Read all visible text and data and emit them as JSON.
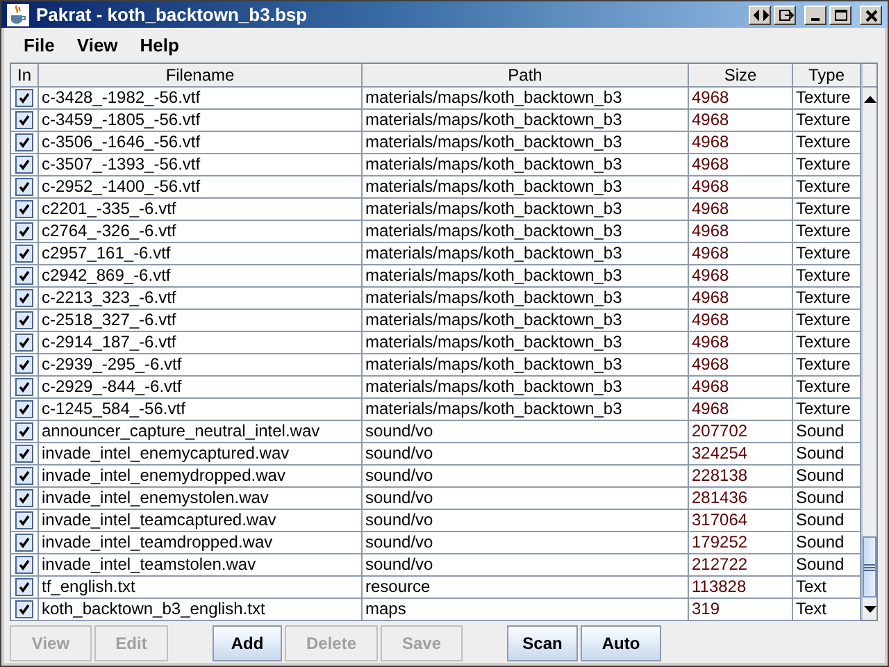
{
  "window": {
    "title": "Pakrat - koth_backtown_b3.bsp"
  },
  "menu": [
    "File",
    "View",
    "Help"
  ],
  "table": {
    "columns": [
      "In",
      "Filename",
      "Path",
      "Size",
      "Type"
    ],
    "rows": [
      {
        "checked": true,
        "filename": "c-3428_-1982_-56.vtf",
        "path": "materials/maps/koth_backtown_b3",
        "size": "4968",
        "type": "Texture"
      },
      {
        "checked": true,
        "filename": "c-3459_-1805_-56.vtf",
        "path": "materials/maps/koth_backtown_b3",
        "size": "4968",
        "type": "Texture"
      },
      {
        "checked": true,
        "filename": "c-3506_-1646_-56.vtf",
        "path": "materials/maps/koth_backtown_b3",
        "size": "4968",
        "type": "Texture"
      },
      {
        "checked": true,
        "filename": "c-3507_-1393_-56.vtf",
        "path": "materials/maps/koth_backtown_b3",
        "size": "4968",
        "type": "Texture"
      },
      {
        "checked": true,
        "filename": "c-2952_-1400_-56.vtf",
        "path": "materials/maps/koth_backtown_b3",
        "size": "4968",
        "type": "Texture"
      },
      {
        "checked": true,
        "filename": "c2201_-335_-6.vtf",
        "path": "materials/maps/koth_backtown_b3",
        "size": "4968",
        "type": "Texture"
      },
      {
        "checked": true,
        "filename": "c2764_-326_-6.vtf",
        "path": "materials/maps/koth_backtown_b3",
        "size": "4968",
        "type": "Texture"
      },
      {
        "checked": true,
        "filename": "c2957_161_-6.vtf",
        "path": "materials/maps/koth_backtown_b3",
        "size": "4968",
        "type": "Texture"
      },
      {
        "checked": true,
        "filename": "c2942_869_-6.vtf",
        "path": "materials/maps/koth_backtown_b3",
        "size": "4968",
        "type": "Texture"
      },
      {
        "checked": true,
        "filename": "c-2213_323_-6.vtf",
        "path": "materials/maps/koth_backtown_b3",
        "size": "4968",
        "type": "Texture"
      },
      {
        "checked": true,
        "filename": "c-2518_327_-6.vtf",
        "path": "materials/maps/koth_backtown_b3",
        "size": "4968",
        "type": "Texture"
      },
      {
        "checked": true,
        "filename": "c-2914_187_-6.vtf",
        "path": "materials/maps/koth_backtown_b3",
        "size": "4968",
        "type": "Texture"
      },
      {
        "checked": true,
        "filename": "c-2939_-295_-6.vtf",
        "path": "materials/maps/koth_backtown_b3",
        "size": "4968",
        "type": "Texture"
      },
      {
        "checked": true,
        "filename": "c-2929_-844_-6.vtf",
        "path": "materials/maps/koth_backtown_b3",
        "size": "4968",
        "type": "Texture"
      },
      {
        "checked": true,
        "filename": "c-1245_584_-56.vtf",
        "path": "materials/maps/koth_backtown_b3",
        "size": "4968",
        "type": "Texture"
      },
      {
        "checked": true,
        "filename": "announcer_capture_neutral_intel.wav",
        "path": "sound/vo",
        "size": "207702",
        "type": "Sound"
      },
      {
        "checked": true,
        "filename": "invade_intel_enemycaptured.wav",
        "path": "sound/vo",
        "size": "324254",
        "type": "Sound"
      },
      {
        "checked": true,
        "filename": "invade_intel_enemydropped.wav",
        "path": "sound/vo",
        "size": "228138",
        "type": "Sound"
      },
      {
        "checked": true,
        "filename": "invade_intel_enemystolen.wav",
        "path": "sound/vo",
        "size": "281436",
        "type": "Sound"
      },
      {
        "checked": true,
        "filename": "invade_intel_teamcaptured.wav",
        "path": "sound/vo",
        "size": "317064",
        "type": "Sound"
      },
      {
        "checked": true,
        "filename": "invade_intel_teamdropped.wav",
        "path": "sound/vo",
        "size": "179252",
        "type": "Sound"
      },
      {
        "checked": true,
        "filename": "invade_intel_teamstolen.wav",
        "path": "sound/vo",
        "size": "212722",
        "type": "Sound"
      },
      {
        "checked": true,
        "filename": "tf_english.txt",
        "path": "resource",
        "size": "113828",
        "type": "Text"
      },
      {
        "checked": true,
        "filename": "koth_backtown_b3_english.txt",
        "path": "maps",
        "size": "319",
        "type": "Text"
      }
    ]
  },
  "button_groups": [
    [
      {
        "label": "View",
        "disabled": true
      },
      {
        "label": "Edit",
        "disabled": true
      }
    ],
    [
      {
        "label": "Add",
        "disabled": false
      },
      {
        "label": "Delete",
        "disabled": true
      },
      {
        "label": "Save",
        "disabled": true
      }
    ],
    [
      {
        "label": "Scan",
        "disabled": false
      },
      {
        "label": "Auto",
        "disabled": false
      }
    ]
  ]
}
